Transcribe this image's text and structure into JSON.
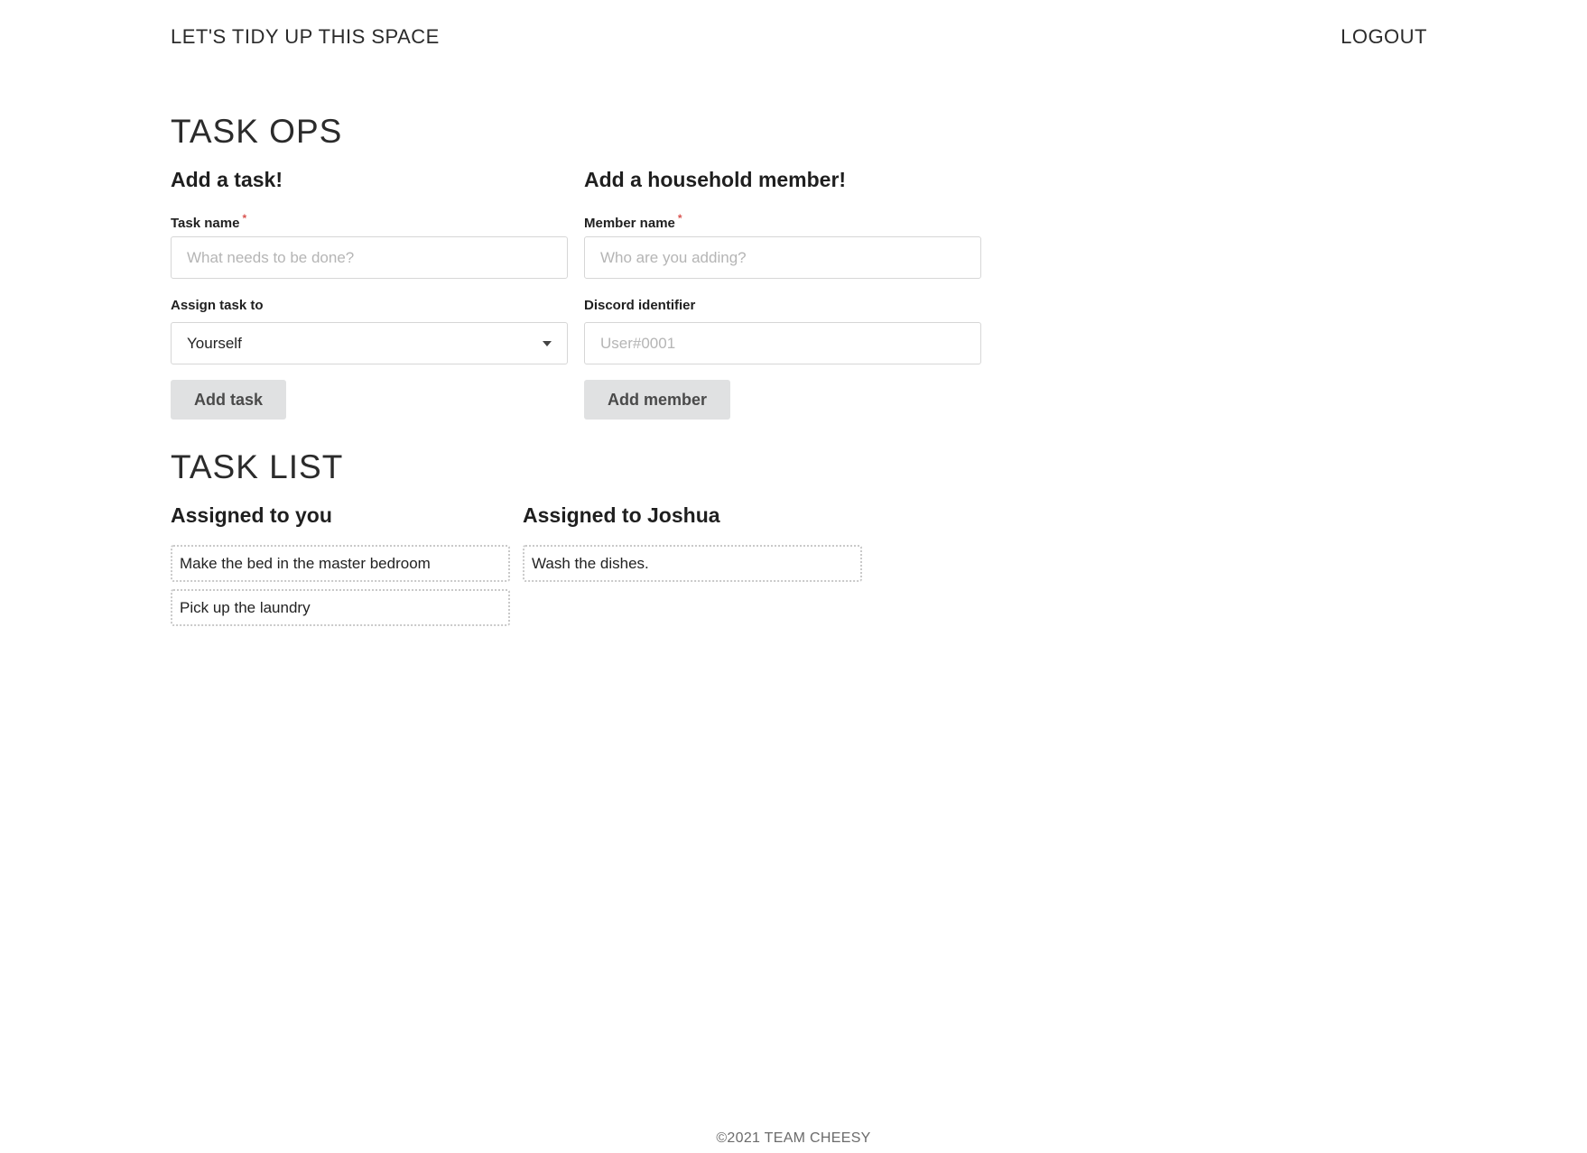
{
  "header": {
    "brand": "LET'S TIDY UP THIS SPACE",
    "logout": "LOGOUT"
  },
  "task_ops": {
    "title": "TASK OPS",
    "add_task": {
      "heading": "Add a task!",
      "task_name_label": "Task name",
      "task_name_placeholder": "What needs to be done?",
      "assign_label": "Assign task to",
      "assign_value": "Yourself",
      "button": "Add task"
    },
    "add_member": {
      "heading": "Add a household member!",
      "member_name_label": "Member name",
      "member_name_placeholder": "Who are you adding?",
      "discord_label": "Discord identifier",
      "discord_placeholder": "User#0001",
      "button": "Add member"
    },
    "required_marker": "*"
  },
  "task_list": {
    "title": "TASK LIST",
    "columns": [
      {
        "heading": "Assigned to you",
        "tasks": [
          "Make the bed in the master bedroom",
          "Pick up the laundry"
        ]
      },
      {
        "heading": "Assigned to Joshua",
        "tasks": [
          "Wash the dishes."
        ]
      }
    ]
  },
  "footer": {
    "text": "©2021 TEAM CHEESY"
  },
  "colors": {
    "required": "#d9534f",
    "button_bg": "#e0e1e2",
    "task_border": "#c9c9c9"
  }
}
